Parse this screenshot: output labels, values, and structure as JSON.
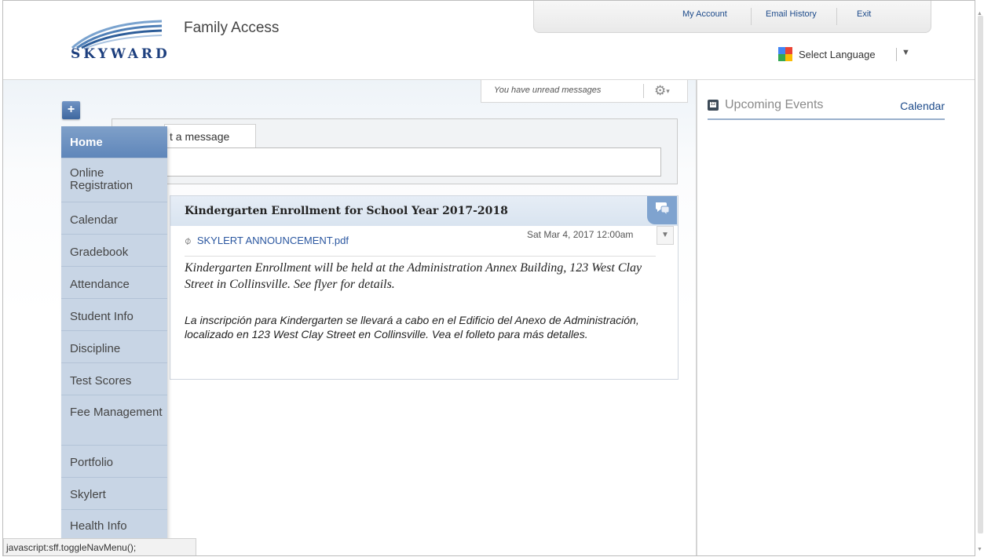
{
  "app": {
    "brand": "SKYWARD",
    "title": "Family Access"
  },
  "top_links": {
    "my_account": "My Account",
    "email_history": "Email History",
    "exit": "Exit"
  },
  "language": {
    "label": "Select Language",
    "arrow": "▼"
  },
  "messages": {
    "unread_text": "You have unread messages"
  },
  "plus_button": "+",
  "post": {
    "tab_label": "Post a message",
    "visible_tab_text": "t a message"
  },
  "nav": {
    "items": [
      {
        "label": "Home",
        "active": true
      },
      {
        "label": "Online Registration"
      },
      {
        "label": "Calendar"
      },
      {
        "label": "Gradebook"
      },
      {
        "label": "Attendance"
      },
      {
        "label": "Student Info"
      },
      {
        "label": "Discipline"
      },
      {
        "label": "Test Scores"
      },
      {
        "label": "Fee Management"
      },
      {
        "label": "Portfolio"
      },
      {
        "label": "Skylert"
      },
      {
        "label": "Health Info"
      }
    ]
  },
  "message": {
    "title": "Kindergarten Enrollment for School Year 2017-2018",
    "attachment": "SKYLERT ANNOUNCEMENT.pdf",
    "date": "Sat Mar 4, 2017 12:00am",
    "body_en": "Kindergarten Enrollment will be held at the Administration Annex Building, 123 West Clay Street in Collinsville.  See flyer for details.",
    "body_es": "La inscripción para Kindergarten se llevará a cabo en el Edificio del Anexo de Administración, localizado en 123 West Clay Street en Collinsville.  Vea el folleto para más detalles."
  },
  "events": {
    "title": "Upcoming Events",
    "calendar_link": "Calendar",
    "icon_text": "12"
  },
  "status_bar": "javascript:sff.toggleNavMenu();",
  "colors": {
    "accent": "#5f86ba",
    "nav_bg": "#c8d5e5",
    "link": "#1c4a8a",
    "brand": "#1d3f7e"
  }
}
